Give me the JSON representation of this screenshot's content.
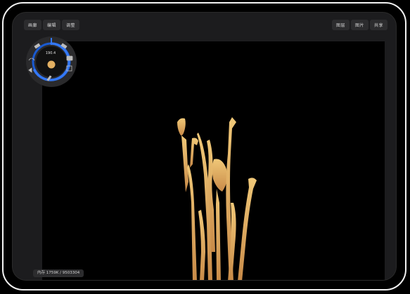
{
  "toolbar": {
    "left": {
      "gallery": "画廊",
      "edit": "编辑",
      "adjust": "调整"
    },
    "right": {
      "layers": "图层",
      "image": "图片",
      "share": "共享"
    }
  },
  "brush_dial": {
    "size_value": "190.4",
    "accent_color": "#3478f6",
    "current_color": "#e3b062"
  },
  "icons": {
    "brush": "brush-icon",
    "pencil": "pencil-icon",
    "eraser": "eraser-icon",
    "smudge": "smudge-icon",
    "undo": "undo-icon",
    "redo": "redo-icon",
    "eyedropper": "eyedropper-icon",
    "transform": "transform-icon"
  },
  "status": {
    "memory": "内存 1759K / 9503304"
  },
  "artwork": {
    "description_color": "#e8b56a"
  }
}
